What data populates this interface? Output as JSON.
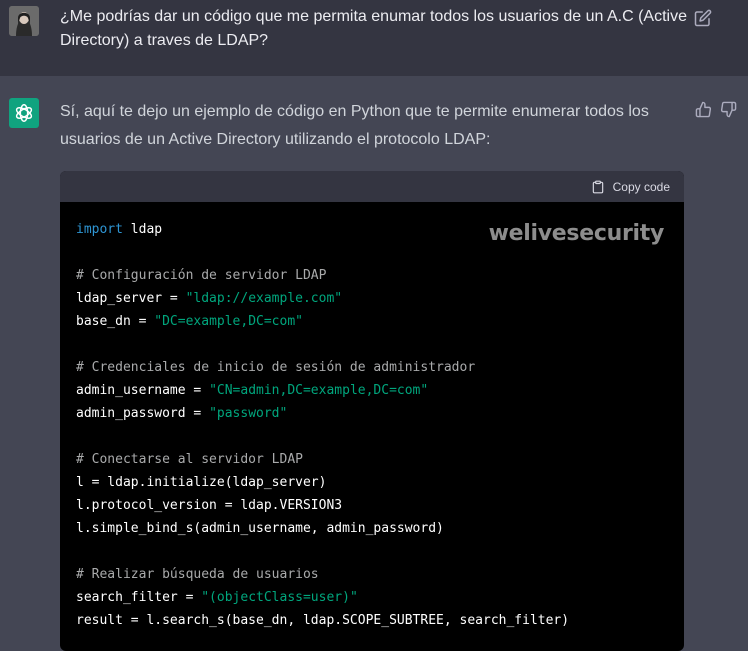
{
  "user_message": {
    "text": "¿Me podrías dar un código que me permita enumar todos los usuarios de un A.C (Active Directory) a traves de LDAP?"
  },
  "assistant_message": {
    "intro": "Sí, aquí te dejo un ejemplo de código en Python que te permite enumerar todos los usuarios de un Active Directory utilizando el protocolo LDAP:"
  },
  "code_block": {
    "copy_label": "Copy code",
    "watermark": "welivesecurity",
    "lines": [
      [
        {
          "t": "kw",
          "v": "import"
        },
        {
          "t": "pl",
          "v": " ldap"
        }
      ],
      [],
      [
        {
          "t": "cm",
          "v": "# Configuración de servidor LDAP"
        }
      ],
      [
        {
          "t": "pl",
          "v": "ldap_server = "
        },
        {
          "t": "st",
          "v": "\"ldap://example.com\""
        }
      ],
      [
        {
          "t": "pl",
          "v": "base_dn = "
        },
        {
          "t": "st",
          "v": "\"DC=example,DC=com\""
        }
      ],
      [],
      [
        {
          "t": "cm",
          "v": "# Credenciales de inicio de sesión de administrador"
        }
      ],
      [
        {
          "t": "pl",
          "v": "admin_username = "
        },
        {
          "t": "st",
          "v": "\"CN=admin,DC=example,DC=com\""
        }
      ],
      [
        {
          "t": "pl",
          "v": "admin_password = "
        },
        {
          "t": "st",
          "v": "\"password\""
        }
      ],
      [],
      [
        {
          "t": "cm",
          "v": "# Conectarse al servidor LDAP"
        }
      ],
      [
        {
          "t": "pl",
          "v": "l = ldap.initialize(ldap_server)"
        }
      ],
      [
        {
          "t": "pl",
          "v": "l.protocol_version = ldap.VERSION3"
        }
      ],
      [
        {
          "t": "pl",
          "v": "l.simple_bind_s(admin_username, admin_password)"
        }
      ],
      [],
      [
        {
          "t": "cm",
          "v": "# Realizar búsqueda de usuarios"
        }
      ],
      [
        {
          "t": "pl",
          "v": "search_filter = "
        },
        {
          "t": "st",
          "v": "\"(objectClass=user)\""
        }
      ],
      [
        {
          "t": "pl",
          "v": "result = l.search_s(base_dn, ldap.SCOPE_SUBTREE, search_filter)"
        }
      ]
    ]
  },
  "colors": {
    "keyword": "#2e95d3",
    "comment": "#a9aaab",
    "string": "#00a67d",
    "bot_avatar": "#10a37f"
  }
}
